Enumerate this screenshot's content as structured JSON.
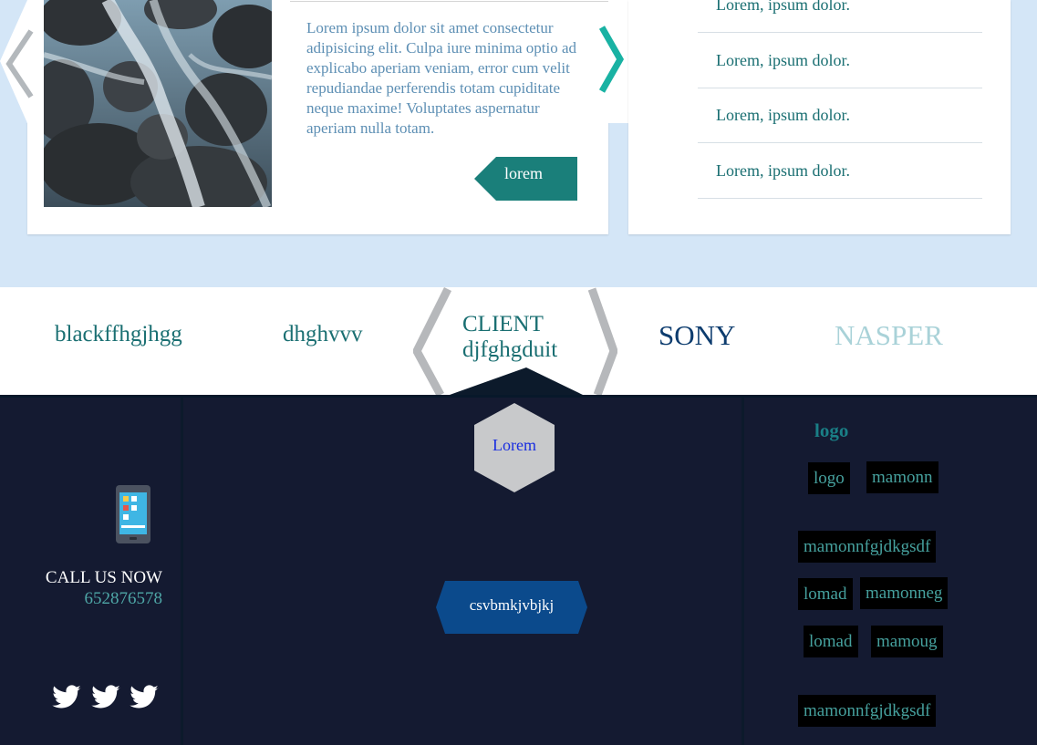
{
  "slider": {
    "text": "Lorem ipsum dolor sit amet consectetur adipisicing elit. Culpa iure minima optio ad explicabo aperiam veniam, error cum velit repudiandae perferendis totam cupiditate neque maxime! Voluptates aspernatur aperiam nulla totam.",
    "button_label": "lorem",
    "prev_icon": "chevron-left-icon",
    "next_icon": "chevron-right-icon"
  },
  "list": {
    "items": [
      "Lorem, ipsum dolor.",
      "Lorem, ipsum dolor.",
      "Lorem, ipsum dolor.",
      "Lorem, ipsum dolor."
    ]
  },
  "clients": {
    "items": [
      "blackffhgjhgg",
      "dhghvvv",
      "SONY",
      "NASPER"
    ],
    "center_title": "CLIENT",
    "center_subtitle": "djfghgduit"
  },
  "footer": {
    "call_title": "CALL US NOW",
    "call_number": "652876578",
    "hex_label": "Lorem",
    "mid_button": "csvbmkjvbjkj",
    "logo_heading": "logo",
    "tags": {
      "row1": [
        "logo",
        "mamonn"
      ],
      "row2": [
        "mamonnfgjdkgsdf"
      ],
      "row3": [
        "lomad",
        "mamonneg"
      ],
      "row4": [
        "lomad",
        "mamoug"
      ],
      "row5": [
        "mamonnfgjdkgsdf"
      ]
    },
    "social_icons": [
      "twitter-icon",
      "twitter-icon",
      "twitter-icon"
    ]
  },
  "colors": {
    "page_bg": "#d4e6f7",
    "teal": "#1a7f7a",
    "accent_arrow": "#19b2a3",
    "footer_bg": "#141a31",
    "button_blue": "#0b4a8c",
    "sony": "#0d3c6e",
    "nasper": "#a9d2d8"
  }
}
